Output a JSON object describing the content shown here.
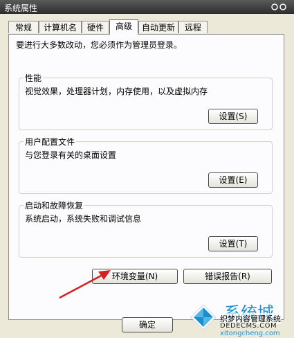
{
  "window": {
    "title": "系统属性"
  },
  "tabs": [
    {
      "label": "常规"
    },
    {
      "label": "计算机名"
    },
    {
      "label": "硬件"
    },
    {
      "label": "高级",
      "active": true
    },
    {
      "label": "自动更新"
    },
    {
      "label": "远程"
    }
  ],
  "intro": "要进行大多数改动，您必须作为管理员登录。",
  "groups": [
    {
      "title": "性能",
      "description": "视觉效果，处理器计划，内存使用，以及虚拟内存",
      "button": "设置(S)"
    },
    {
      "title": "用户配置文件",
      "description": "与您登录有关的桌面设置",
      "button": "设置(E)"
    },
    {
      "title": "启动和故障恢复",
      "description": "系统启动，系统失败和调试信息",
      "button": "设置(T)"
    }
  ],
  "env_button": "环境变量(N)",
  "error_button": "错误报告(R)",
  "ok_button": "确定",
  "watermark": {
    "big": "系统城",
    "line1": "织梦内容管理系统",
    "line2": "DEDECMS.COM",
    "line3": "xitongcheng.com"
  },
  "colors": {
    "arrow": "#d42020",
    "title_bg": "#3a3a3a",
    "panel_bg": "#fcfcfe",
    "window_bg": "#ece9d8"
  }
}
